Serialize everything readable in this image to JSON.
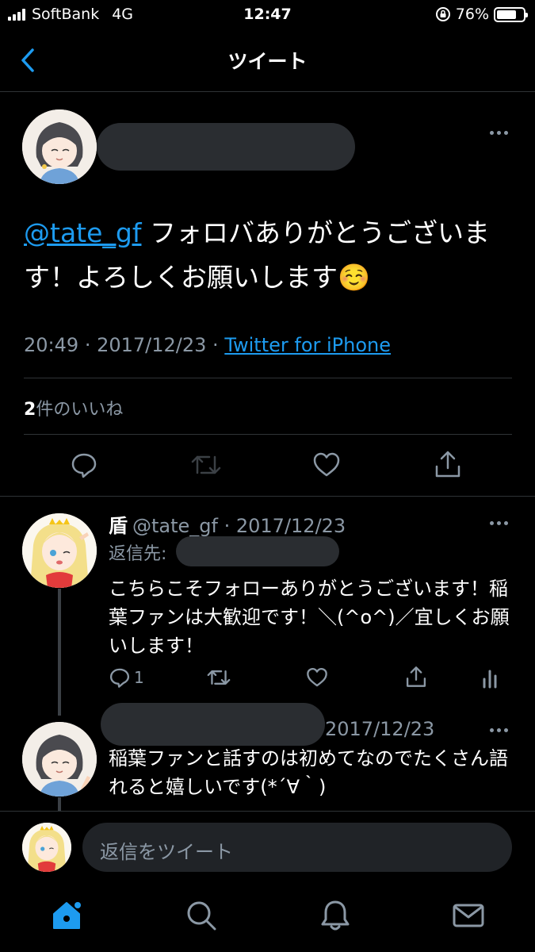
{
  "status": {
    "carrier": "SoftBank",
    "network": "4G",
    "time": "12:47",
    "battery": "76%",
    "battery_level": 0.76
  },
  "header": {
    "title": "ツイート"
  },
  "tweet": {
    "mention": "@tate_gf",
    "text": "フォロバありがとうございます！よろしくお願いします☺️",
    "time": "20:49",
    "date": "2017/12/23",
    "source": "Twitter for iPhone",
    "likes_count": "2",
    "likes_label": "件のいいね"
  },
  "reply1": {
    "name": "盾",
    "handle": "@tate_gf",
    "date": "2017/12/23",
    "reply_to_label": "返信先:",
    "text": "こちらこそフォローありがとうございます！稲葉ファンは大歓迎です！＼(^o^)／宜しくお願いします！",
    "reply_count": "1"
  },
  "reply2": {
    "date": "2017/12/23",
    "text": "稲葉ファンと話すのは初めてなのでたくさん語れると嬉しいです(*´∀｀)"
  },
  "compose": {
    "placeholder": "返信をツイート"
  },
  "colors": {
    "accent": "#1d9bf0",
    "muted": "#8b98a5",
    "background": "#000000"
  }
}
